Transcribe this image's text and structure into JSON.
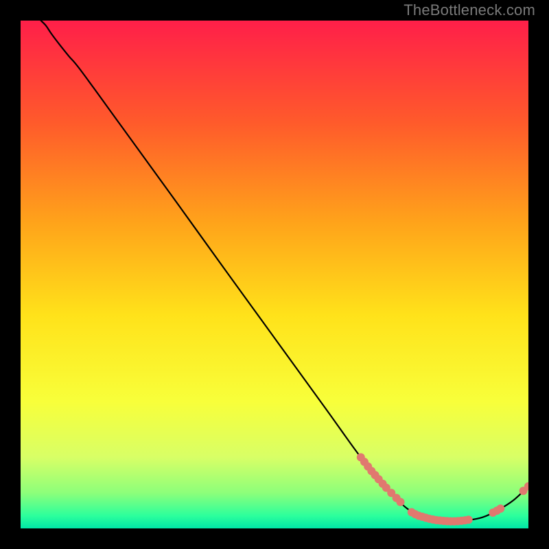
{
  "watermark": "TheBottleneck.com",
  "chart_data": {
    "type": "line",
    "title": "",
    "xlabel": "",
    "ylabel": "",
    "xlim": [
      0,
      100
    ],
    "ylim": [
      0,
      100
    ],
    "gradient_stops": [
      {
        "offset": 0.0,
        "color": "#ff1f49"
      },
      {
        "offset": 0.2,
        "color": "#ff5a2b"
      },
      {
        "offset": 0.4,
        "color": "#ffa41a"
      },
      {
        "offset": 0.58,
        "color": "#ffe21a"
      },
      {
        "offset": 0.75,
        "color": "#f8ff3a"
      },
      {
        "offset": 0.86,
        "color": "#d8ff66"
      },
      {
        "offset": 0.93,
        "color": "#8dff7a"
      },
      {
        "offset": 0.975,
        "color": "#2cff9c"
      },
      {
        "offset": 1.0,
        "color": "#00e6a6"
      }
    ],
    "curve": [
      {
        "x": 4.0,
        "y": 100.0
      },
      {
        "x": 5.0,
        "y": 99.0
      },
      {
        "x": 6.0,
        "y": 97.5
      },
      {
        "x": 7.5,
        "y": 95.5
      },
      {
        "x": 9.5,
        "y": 93.0
      },
      {
        "x": 12.0,
        "y": 90.0
      },
      {
        "x": 20.0,
        "y": 79.0
      },
      {
        "x": 30.0,
        "y": 65.2
      },
      {
        "x": 40.0,
        "y": 51.3
      },
      {
        "x": 50.0,
        "y": 37.5
      },
      {
        "x": 60.0,
        "y": 23.7
      },
      {
        "x": 67.0,
        "y": 14.0
      },
      {
        "x": 72.0,
        "y": 8.0
      },
      {
        "x": 76.0,
        "y": 4.0
      },
      {
        "x": 79.0,
        "y": 2.4
      },
      {
        "x": 82.0,
        "y": 1.6
      },
      {
        "x": 85.0,
        "y": 1.4
      },
      {
        "x": 88.0,
        "y": 1.6
      },
      {
        "x": 91.0,
        "y": 2.2
      },
      {
        "x": 94.0,
        "y": 3.6
      },
      {
        "x": 97.0,
        "y": 5.5
      },
      {
        "x": 100.0,
        "y": 8.3
      }
    ],
    "marker_series": [
      {
        "name": "segment-upper",
        "points": [
          {
            "x": 67.0,
            "y": 14.0
          },
          {
            "x": 67.7,
            "y": 13.1
          },
          {
            "x": 68.4,
            "y": 12.2
          },
          {
            "x": 69.1,
            "y": 11.3
          },
          {
            "x": 69.8,
            "y": 10.5
          },
          {
            "x": 70.5,
            "y": 9.7
          },
          {
            "x": 71.3,
            "y": 8.8
          },
          {
            "x": 72.0,
            "y": 8.0
          },
          {
            "x": 73.0,
            "y": 7.0
          }
        ]
      },
      {
        "name": "segment-gap-pair",
        "points": [
          {
            "x": 74.0,
            "y": 6.0
          },
          {
            "x": 74.8,
            "y": 5.2
          }
        ]
      },
      {
        "name": "segment-bottom",
        "points": [
          {
            "x": 77.0,
            "y": 3.2
          },
          {
            "x": 77.7,
            "y": 2.8
          },
          {
            "x": 78.4,
            "y": 2.5
          },
          {
            "x": 79.1,
            "y": 2.3
          },
          {
            "x": 79.8,
            "y": 2.1
          },
          {
            "x": 80.5,
            "y": 1.9
          },
          {
            "x": 81.2,
            "y": 1.75
          },
          {
            "x": 81.9,
            "y": 1.62
          },
          {
            "x": 82.6,
            "y": 1.55
          },
          {
            "x": 83.3,
            "y": 1.48
          },
          {
            "x": 84.0,
            "y": 1.43
          },
          {
            "x": 84.7,
            "y": 1.4
          },
          {
            "x": 85.4,
            "y": 1.4
          },
          {
            "x": 86.1,
            "y": 1.43
          },
          {
            "x": 86.8,
            "y": 1.5
          },
          {
            "x": 87.5,
            "y": 1.58
          },
          {
            "x": 88.2,
            "y": 1.7
          }
        ]
      },
      {
        "name": "segment-rise",
        "points": [
          {
            "x": 93.0,
            "y": 3.1
          },
          {
            "x": 93.8,
            "y": 3.5
          },
          {
            "x": 94.5,
            "y": 3.9
          }
        ]
      },
      {
        "name": "segment-tip",
        "points": [
          {
            "x": 99.0,
            "y": 7.4
          },
          {
            "x": 100.0,
            "y": 8.3
          }
        ]
      }
    ],
    "style": {
      "curve_stroke": "#000000",
      "curve_width": 2.2,
      "marker_fill": "#e0796f",
      "marker_radius": 6
    }
  }
}
